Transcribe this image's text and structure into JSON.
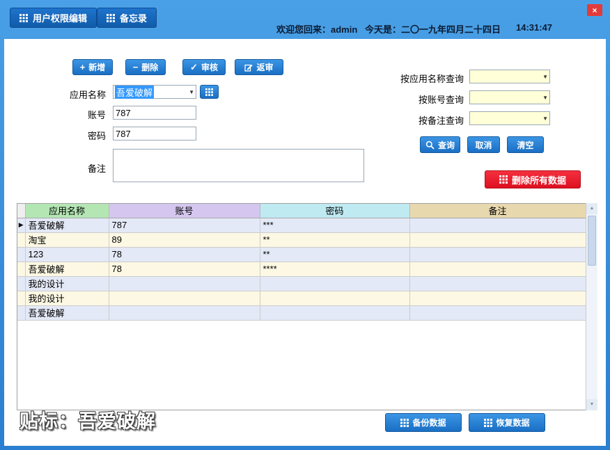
{
  "window": {
    "close": "×"
  },
  "topbar": {
    "tabs": [
      {
        "label": "用户权限编辑"
      },
      {
        "label": "备忘录"
      }
    ],
    "welcome": "欢迎您回来：admin",
    "date": "今天是：二〇一九年四月二十四日",
    "time": "14:31:47"
  },
  "toolbar": {
    "add": "新增",
    "delete": "删除",
    "audit": "审核",
    "return_audit": "返审",
    "add_glyph": "+",
    "delete_glyph": "−",
    "audit_glyph": "✓"
  },
  "form": {
    "app_name_label": "应用名称",
    "app_name_value": "吾爱破解",
    "account_label": "账号",
    "account_value": "787",
    "password_label": "密码",
    "password_value": "787",
    "remark_label": "备注",
    "remark_value": ""
  },
  "search": {
    "by_app_label": "按应用名称查询",
    "by_account_label": "按账号查询",
    "by_remark_label": "按备注查询",
    "query_label": "查询",
    "cancel_label": "取消",
    "clear_label": "清空",
    "delete_all_label": "删除所有数据"
  },
  "table": {
    "columns": [
      "应用名称",
      "账号",
      "密码",
      "备注"
    ],
    "selected_row": 0,
    "selector_glyph": "▶",
    "rows": [
      [
        "吾爱破解",
        "787",
        "***",
        ""
      ],
      [
        "淘宝",
        "89",
        "**",
        ""
      ],
      [
        "123",
        "78",
        "**",
        ""
      ],
      [
        "吾爱破解",
        "78",
        "****",
        ""
      ],
      [
        "我的设计",
        "",
        "",
        ""
      ],
      [
        "我的设计",
        "",
        "",
        ""
      ],
      [
        "吾爱破解",
        "",
        "",
        ""
      ]
    ]
  },
  "footer": {
    "watermark": "贴标：吾爱破解",
    "backup_label": "备份数据",
    "restore_label": "恢复数据"
  },
  "colors": {
    "accent_blue": "#1a6fc4",
    "danger_red": "#ee1c25",
    "header_green": "#b4e6b4",
    "header_purple": "#d5c6f0",
    "header_cyan": "#bfeaf2",
    "header_tan": "#e8d8ae"
  }
}
